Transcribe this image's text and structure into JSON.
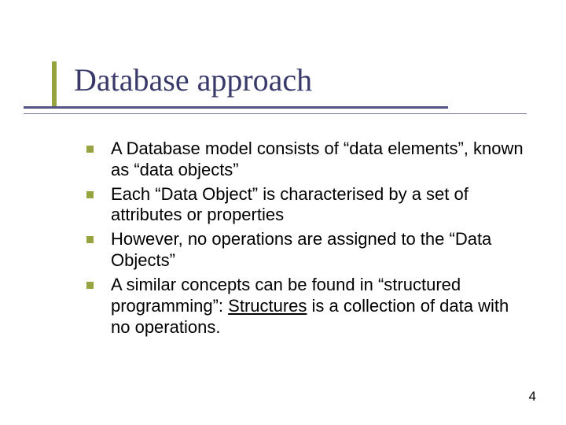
{
  "slide": {
    "title": "Database approach",
    "bullets": [
      {
        "text": "A Database model consists of “data elements”, known as “data objects”"
      },
      {
        "text": "Each “Data Object” is characterised by a set of attributes or properties"
      },
      {
        "text": "However, no operations are assigned to the “Data Objects”"
      },
      {
        "prefix": "A similar concepts can be found in “structured programming”: ",
        "underlined": "Structures",
        "suffix": " is a collection of data with no operations."
      }
    ],
    "page_number": "4"
  }
}
